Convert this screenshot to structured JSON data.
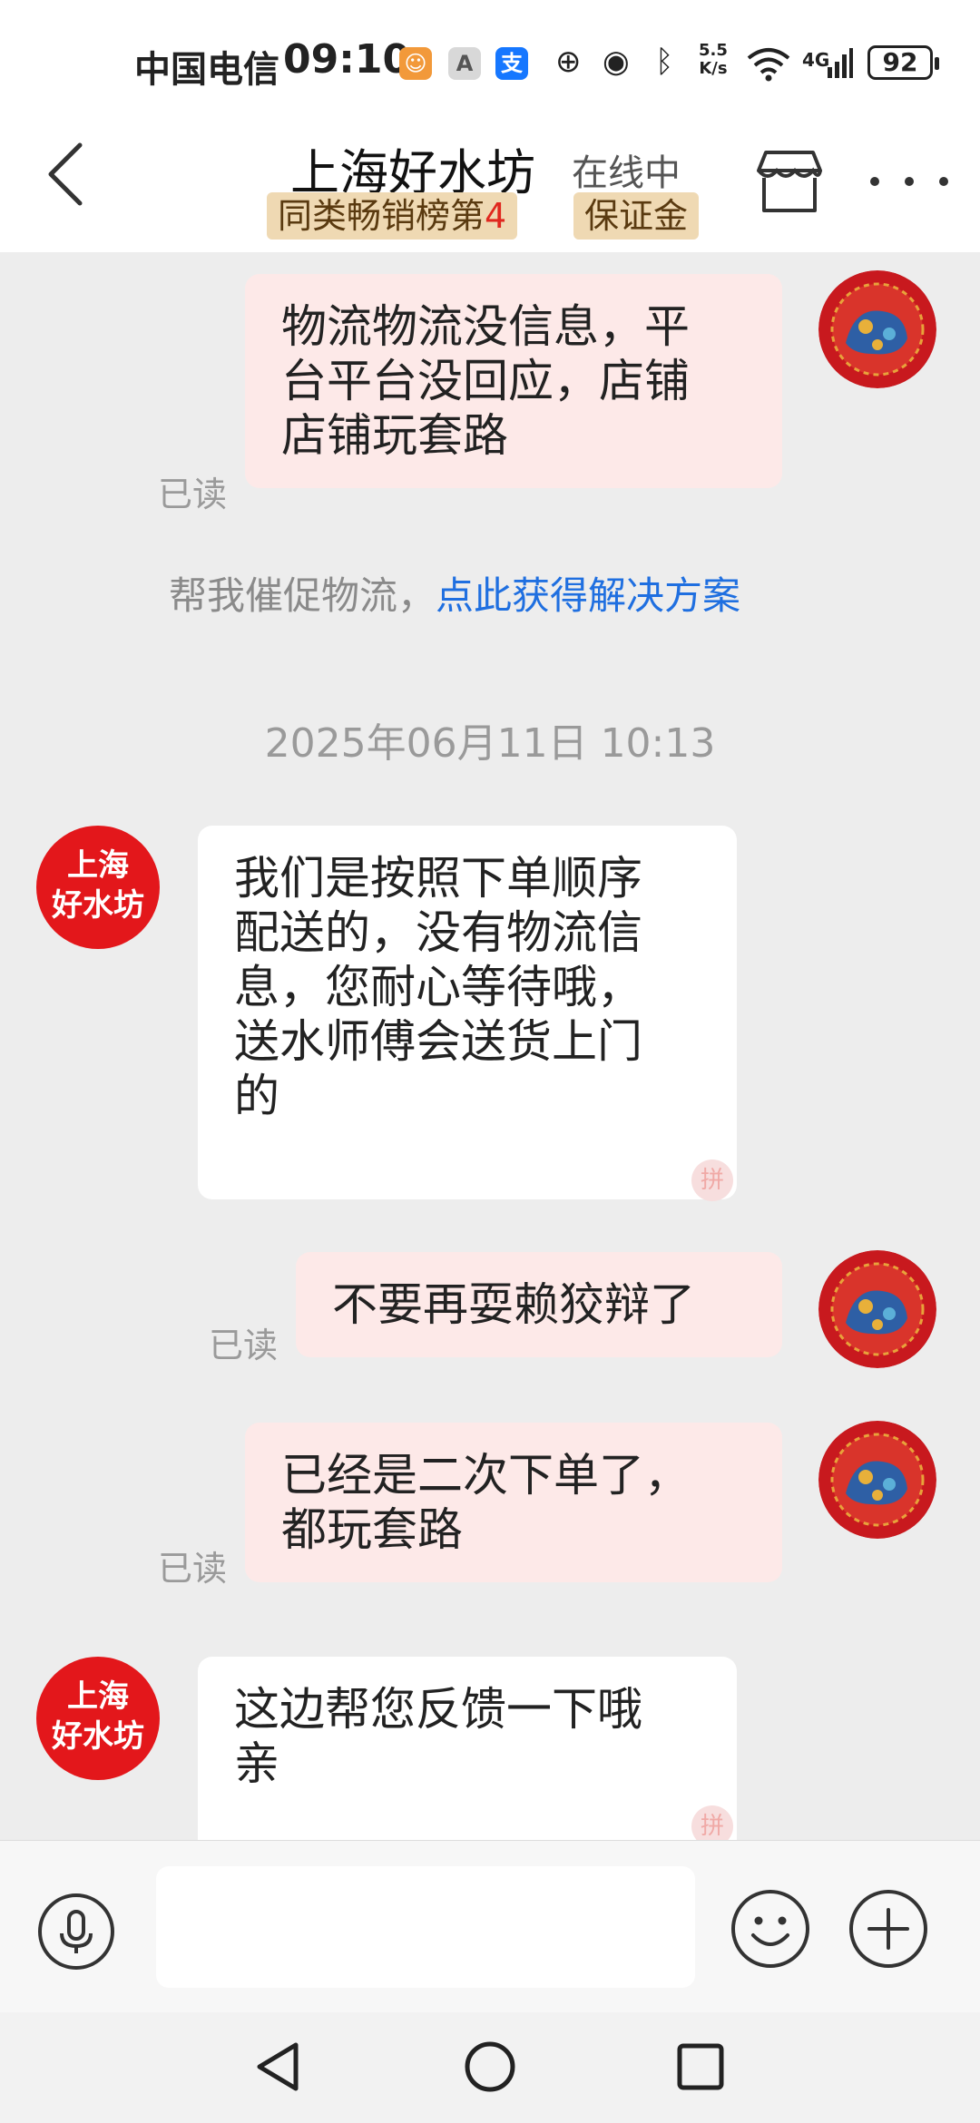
{
  "status_bar": {
    "carrier": "中国电信",
    "time": "09:10",
    "net_speed_value": "5.5",
    "net_speed_unit": "K/s",
    "network": "4G",
    "battery": "92",
    "app_icon_a": "A",
    "app_icon_pay": "支"
  },
  "header": {
    "title": "上海好水坊",
    "online_status": "在线中",
    "rank_badge_prefix": "同类畅销榜第",
    "rank_badge_number": "4",
    "deposit_badge": "保证金"
  },
  "chat": {
    "messages": [
      {
        "from": "me",
        "text": "物流物流没信息，平\n台平台没回应，店铺\n店铺玩套路",
        "read": "已读"
      },
      {
        "from": "shop",
        "avatar_line1": "上海",
        "avatar_line2": "好水坊",
        "text": "我们是按照下单顺序\n配送的，没有物流信\n息，您耐心等待哦，\n送水师傅会送货上门\n的",
        "stamp": "拼"
      },
      {
        "from": "me",
        "text": "不要再耍赖狡辩了",
        "read": "已读"
      },
      {
        "from": "me",
        "text": "已经是二次下单了，\n都玩套路",
        "read": "已读"
      },
      {
        "from": "shop",
        "avatar_line1": "上海",
        "avatar_line2": "好水坊",
        "text": "这边帮您反馈一下哦\n亲",
        "stamp": "拼"
      }
    ],
    "promo_text": "帮我催促物流，",
    "promo_link": "点此获得解决方案",
    "timestamp": "2025年06月11日 10:13"
  },
  "colors": {
    "my_bubble": "#fde9e8",
    "shop_avatar": "#e3171b",
    "link": "#1f6fe0",
    "badge_bg": "#efd9b3"
  }
}
